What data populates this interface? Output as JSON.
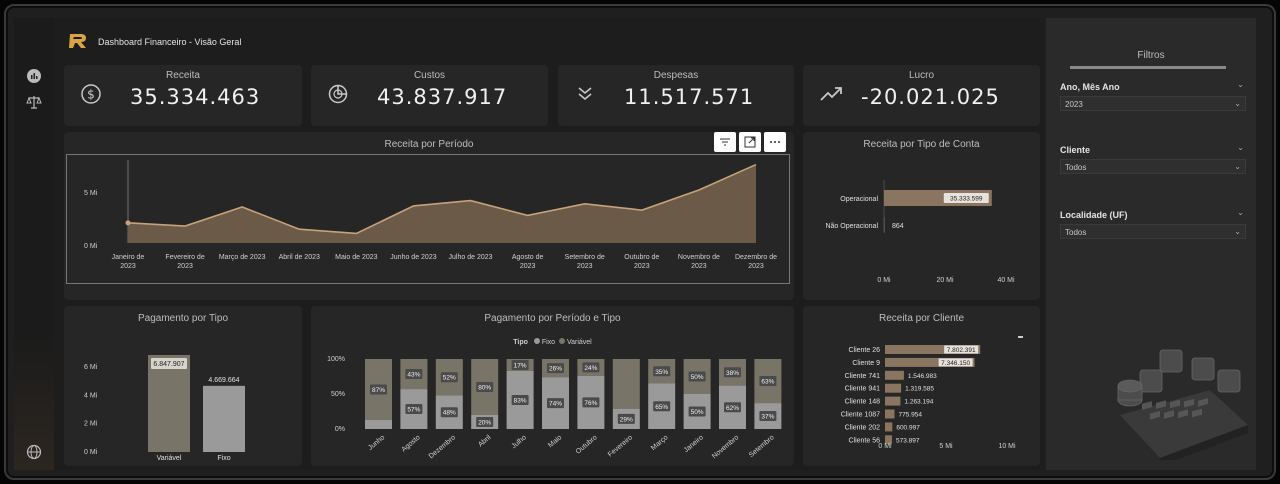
{
  "header": {
    "title": "Dashboard Financeiro - Visão Geral"
  },
  "kpis": [
    {
      "title": "Receita",
      "value": "35.334.463",
      "icon": "dollar-circle-icon"
    },
    {
      "title": "Custos",
      "value": "43.837.917",
      "icon": "pie-chart-icon"
    },
    {
      "title": "Despesas",
      "value": "11.517.571",
      "icon": "double-chevron-down-icon"
    },
    {
      "title": "Lucro",
      "value": "-20.021.025",
      "icon": "trend-up-icon"
    }
  ],
  "colors": {
    "accent": "#8a7560",
    "fixo": "#9a9a9a",
    "variavel": "#787468",
    "panel": "#262626"
  },
  "charts": {
    "periodo": {
      "title": "Receita por Período",
      "y_ticks": [
        "5 Mi",
        "0 Mi"
      ],
      "x_labels": [
        [
          "Janeiro de",
          "2023"
        ],
        [
          "Fevereiro de",
          "2023"
        ],
        [
          "Março de 2023",
          ""
        ],
        [
          "Abril de 2023",
          ""
        ],
        [
          "Maio de 2023",
          ""
        ],
        [
          "Junho de 2023",
          ""
        ],
        [
          "Julho de 2023",
          ""
        ],
        [
          "Agosto de",
          "2023"
        ],
        [
          "Setembro de",
          "2023"
        ],
        [
          "Outubro de",
          "2023"
        ],
        [
          "Novembro de",
          "2023"
        ],
        [
          "Dezembro de",
          "2023"
        ]
      ]
    },
    "tipo_conta": {
      "title": "Receita por Tipo de Conta",
      "rows": [
        {
          "label": "Operacional",
          "value_text": "35.333.599"
        },
        {
          "label": "Não Operacional",
          "value_text": "864"
        }
      ],
      "x_ticks": [
        "0 Mi",
        "20 Mi",
        "40 Mi"
      ]
    },
    "pagamento_tipo": {
      "title": "Pagamento por Tipo",
      "y_ticks": [
        "6 Mi",
        "4 Mi",
        "2 Mi",
        "0 Mi"
      ],
      "bars": [
        {
          "label": "Variável",
          "value_text": "6.847.907"
        },
        {
          "label": "Fixo",
          "value_text": "4.669.664"
        }
      ]
    },
    "pagamento_periodo": {
      "title": "Pagamento por Período e Tipo",
      "legend_title": "Tipo",
      "legend": [
        "Fixo",
        "Variável"
      ],
      "y_ticks": [
        "100%",
        "50%",
        "0%"
      ],
      "months": [
        "Junho",
        "Agosto",
        "Dezembro",
        "Abril",
        "Julho",
        "Maio",
        "Outubro",
        "Fevereiro",
        "Março",
        "Janeiro",
        "Novembro",
        "Setembro"
      ],
      "top_labels": [
        "87%",
        "43%",
        "52%",
        "80%",
        "17%",
        "26%",
        "24%",
        "",
        "35%",
        "50%",
        "38%",
        "63%"
      ],
      "bottom_labels": [
        "",
        "57%",
        "48%",
        "20%",
        "83%",
        "74%",
        "76%",
        "29%",
        "65%",
        "50%",
        "62%",
        "37%"
      ]
    },
    "cliente": {
      "title": "Receita por Cliente",
      "rows": [
        {
          "label": "Cliente 26",
          "value_text": "7.802.391"
        },
        {
          "label": "Cliente 9",
          "value_text": "7.346.150"
        },
        {
          "label": "Cliente 741",
          "value_text": "1.546.983"
        },
        {
          "label": "Cliente 941",
          "value_text": "1.319.585"
        },
        {
          "label": "Cliente 148",
          "value_text": "1.263.194"
        },
        {
          "label": "Cliente 1087",
          "value_text": "775.954"
        },
        {
          "label": "Cliente 202",
          "value_text": "600.997"
        },
        {
          "label": "Cliente 56",
          "value_text": "573.897"
        }
      ],
      "x_ticks": [
        "0 Mi",
        "5 Mi",
        "10 Mi"
      ]
    }
  },
  "chart_data": [
    {
      "type": "area",
      "title": "Receita por Período",
      "categories": [
        "Janeiro de 2023",
        "Fevereiro de 2023",
        "Março de 2023",
        "Abril de 2023",
        "Maio de 2023",
        "Junho de 2023",
        "Julho de 2023",
        "Agosto de 2023",
        "Setembro de 2023",
        "Outubro de 2023",
        "Novembro de 2023",
        "Dezembro de 2023"
      ],
      "values": [
        1.9,
        1.6,
        3.4,
        1.3,
        0.9,
        3.5,
        4.0,
        2.6,
        3.7,
        3.1,
        5.0,
        7.4
      ],
      "ylim": [
        0,
        7.8
      ],
      "y_unit": "Mi"
    },
    {
      "type": "bar",
      "title": "Receita por Tipo de Conta",
      "categories": [
        "Operacional",
        "Não Operacional"
      ],
      "values": [
        35333599,
        864
      ],
      "xlim": [
        0,
        40000000
      ]
    },
    {
      "type": "bar",
      "title": "Pagamento por Tipo",
      "categories": [
        "Variável",
        "Fixo"
      ],
      "values": [
        6847907,
        4669664
      ],
      "ylim": [
        0,
        7000000
      ]
    },
    {
      "type": "bar",
      "title": "Pagamento por Período e Tipo",
      "stacked_percent": true,
      "categories": [
        "Junho",
        "Agosto",
        "Dezembro",
        "Abril",
        "Julho",
        "Maio",
        "Outubro",
        "Fevereiro",
        "Março",
        "Janeiro",
        "Novembro",
        "Setembro"
      ],
      "series": [
        {
          "name": "Fixo",
          "values": [
            13,
            57,
            48,
            20,
            83,
            74,
            76,
            29,
            65,
            50,
            62,
            37
          ]
        },
        {
          "name": "Variável",
          "values": [
            87,
            43,
            52,
            80,
            17,
            26,
            24,
            71,
            35,
            50,
            38,
            63
          ]
        }
      ]
    },
    {
      "type": "bar",
      "title": "Receita por Cliente",
      "categories": [
        "Cliente 26",
        "Cliente 9",
        "Cliente 741",
        "Cliente 941",
        "Cliente 148",
        "Cliente 1087",
        "Cliente 202",
        "Cliente 56"
      ],
      "values": [
        7802391,
        7346150,
        1546983,
        1319585,
        1263194,
        775954,
        600997,
        573897
      ],
      "xlim": [
        0,
        10000000
      ]
    }
  ],
  "filters": {
    "title": "Filtros",
    "items": [
      {
        "label": "Ano, Mês Ano",
        "value": "2023"
      },
      {
        "label": "Cliente",
        "value": "Todos"
      },
      {
        "label": "Localidade (UF)",
        "value": "Todos"
      }
    ]
  }
}
